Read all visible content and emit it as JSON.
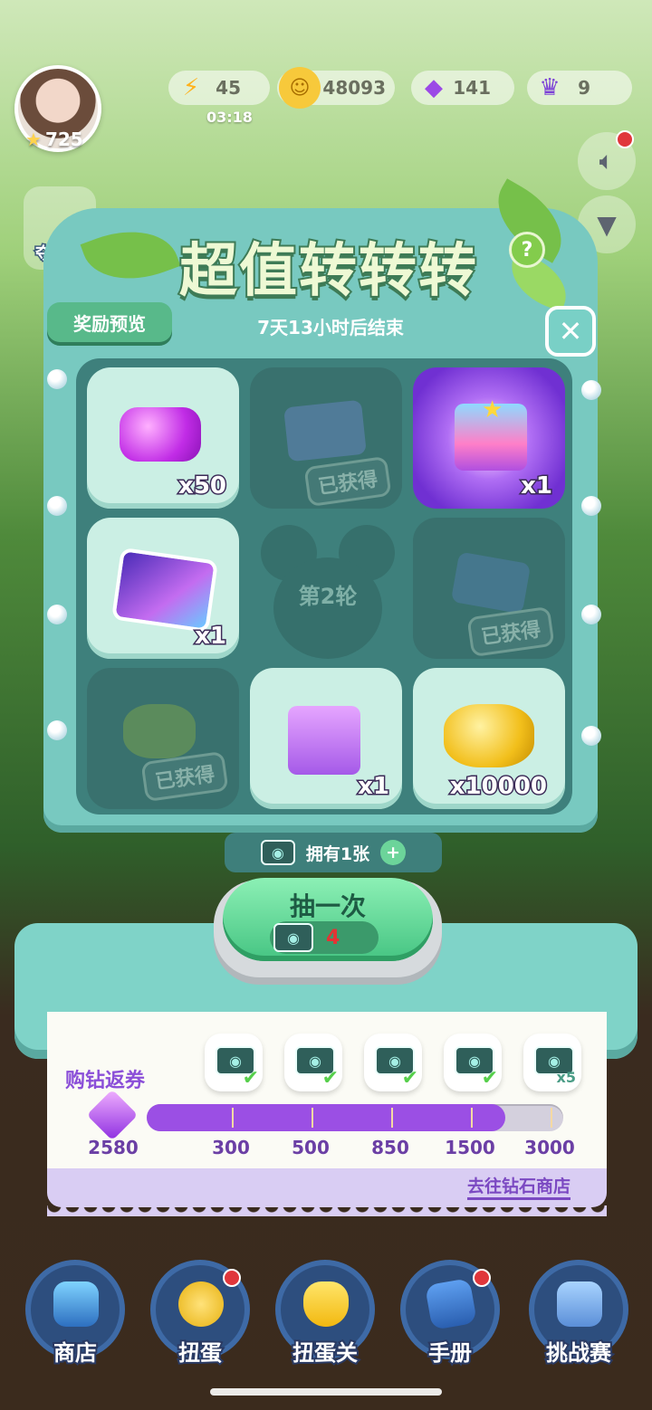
{
  "hud": {
    "level": "725",
    "energy": "45",
    "energy_timer": "03:18",
    "coins": "48093",
    "gems": "141",
    "crowns": "9"
  },
  "panel": {
    "title": "超值转转转",
    "help": "?",
    "preview_label": "奖励预览",
    "countdown": "7天13小时后结束",
    "close": "✕"
  },
  "rewards": [
    {
      "qty": "x50",
      "state": "available",
      "icon": "gems-icon"
    },
    {
      "qty": "",
      "state": "obtained",
      "label": "已获得",
      "icon": "card-pack-icon"
    },
    {
      "qty": "x1",
      "state": "featured",
      "icon": "ssr-gift-box-icon"
    },
    {
      "qty": "x1",
      "state": "available",
      "icon": "mickey-card-icon"
    },
    {
      "qty": "",
      "state": "round",
      "label": "第2轮",
      "icon": "mickey-silhouette-icon"
    },
    {
      "qty": "",
      "state": "obtained",
      "label": "已获得",
      "icon": "ticket-icon"
    },
    {
      "qty": "",
      "state": "obtained",
      "label": "已获得",
      "icon": "coin-stack-icon"
    },
    {
      "qty": "x1",
      "state": "available",
      "icon": "mystery-gift-box-icon"
    },
    {
      "qty": "x10000",
      "state": "available",
      "icon": "gold-coins-icon"
    }
  ],
  "tickets": {
    "owned_label": "拥有1张",
    "plus": "+"
  },
  "draw": {
    "label": "抽一次",
    "cost": "4"
  },
  "purchase": {
    "label": "购钻返券",
    "current_diamonds": "2580",
    "progress_fraction": 0.86,
    "milestones": [
      {
        "value": "300",
        "claimed": true
      },
      {
        "value": "500",
        "claimed": true
      },
      {
        "value": "850",
        "claimed": true
      },
      {
        "value": "1500",
        "claimed": true
      },
      {
        "value": "3000",
        "claimed": false,
        "reward": "x5"
      }
    ],
    "shop_link": "去往钻石商店"
  },
  "nav": [
    {
      "label": "商店",
      "badge": false
    },
    {
      "label": "扭蛋",
      "badge": true
    },
    {
      "label": "扭蛋关",
      "badge": false
    },
    {
      "label": "手册",
      "badge": true
    },
    {
      "label": "挑战赛",
      "badge": false
    }
  ],
  "side": {
    "left_label_1": "夺宝奇"
  }
}
